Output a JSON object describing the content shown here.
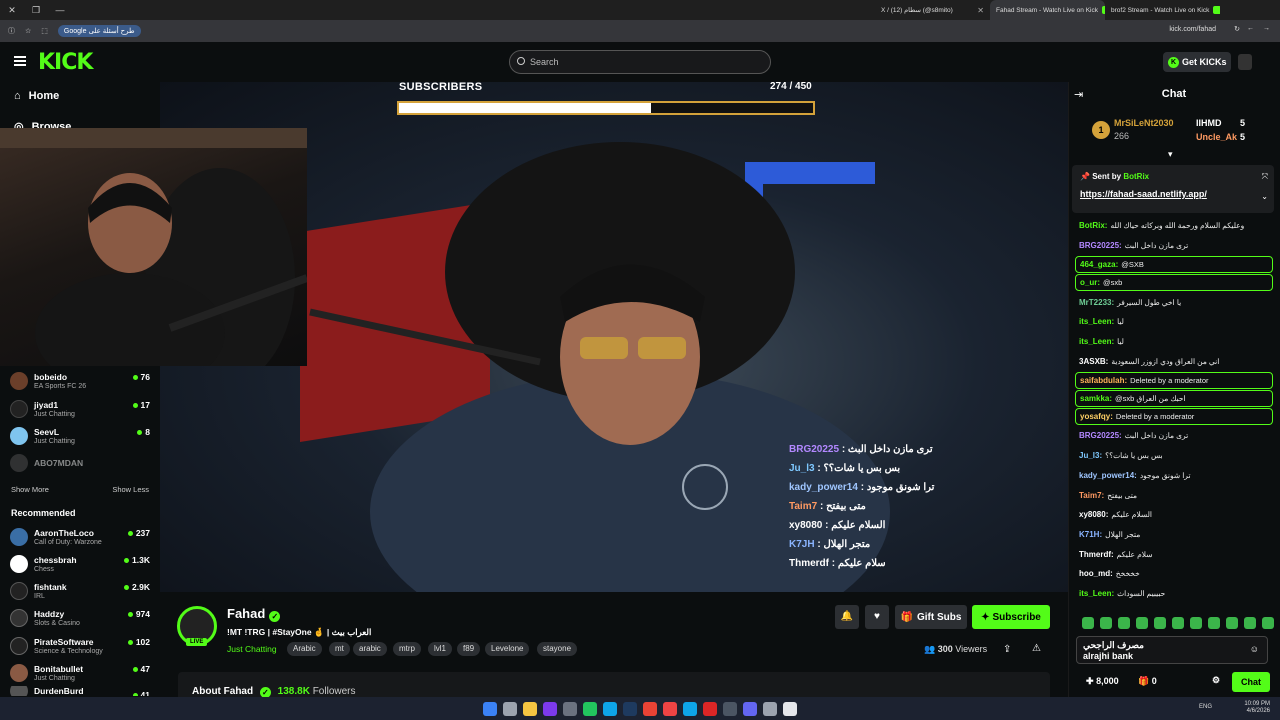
{
  "browser": {
    "tabs": [
      {
        "label": "X / (12) سطام (@s8mito)",
        "active": false
      },
      {
        "label": "Fahad Stream - Watch Live on Kick",
        "active": true
      },
      {
        "label": "brof2 Stream - Watch Live on Kick",
        "active": false
      }
    ],
    "bookmark_chip": "Google طرح أسئلة على",
    "url": "kick.com/fahad"
  },
  "kick_header": {
    "logo": "KICK",
    "search_placeholder": "Search",
    "get_kicks": "Get KICKs"
  },
  "sidebar": {
    "home": "Home",
    "browse": "Browse",
    "following": [
      {
        "name": "bobeido",
        "game": "EA Sports FC 26",
        "viewers": "76",
        "color": "#6b3f2a"
      },
      {
        "name": "jiyad1",
        "game": "Just Chatting",
        "viewers": "17",
        "color": "#222"
      },
      {
        "name": "SeevL",
        "game": "Just Chatting",
        "viewers": "8",
        "color": "#7fc4ee"
      },
      {
        "name": "ABO7MDAN",
        "game": "",
        "viewers": "",
        "color": "#555"
      }
    ],
    "show_more": "Show More",
    "show_less": "Show Less",
    "recommended_title": "Recommended",
    "recommended": [
      {
        "name": "AaronTheLoco",
        "game": "Call of Duty: Warzone",
        "viewers": "237",
        "color": "#3a6ea5"
      },
      {
        "name": "chessbrah",
        "game": "Chess",
        "viewers": "1.3K",
        "color": "#fff"
      },
      {
        "name": "fishtank",
        "game": "IRL",
        "viewers": "2.9K",
        "color": "#222"
      },
      {
        "name": "Haddzy",
        "game": "Slots & Casino",
        "viewers": "974",
        "color": "#333"
      },
      {
        "name": "PirateSoftware",
        "game": "Science & Technology",
        "viewers": "102",
        "color": "#222"
      },
      {
        "name": "Bonitabullet",
        "game": "Just Chatting",
        "viewers": "47",
        "color": "#8a5a44"
      },
      {
        "name": "DurdenBurd",
        "game": "",
        "viewers": "41",
        "color": "#555"
      }
    ]
  },
  "overlay": {
    "subscribers_label": "SUBSCRIBERS",
    "subscribers_count": "274 / 450",
    "subscribers_progress": 0.609,
    "chat": [
      {
        "user": "BRG20225",
        "text": ": ترى مازن داخل البث",
        "color": "#b388ff"
      },
      {
        "user": "Ju_l3",
        "text": ": بس بس يا شات؟؟",
        "color": "#7ec8ff"
      },
      {
        "user": "kady_power14",
        "text": ": ترا شونق موجود",
        "color": "#9fc6ff"
      },
      {
        "user": "Taim7",
        "text": ": متى بيفتح",
        "color": "#ff9a62"
      },
      {
        "user": "xy8080",
        "text": ": السلام عليكم",
        "color": "#ffffff"
      },
      {
        "user": "K7JH",
        "text": ": متجر الهلال",
        "color": "#8ab4ff"
      },
      {
        "user": "Thmerdf",
        "text": ": سلام عليكم",
        "color": "#ffffff"
      }
    ]
  },
  "stream": {
    "name": "Fahad",
    "live": "LIVE",
    "title": "!MT !TRG | #StayOne 🤞 | العراب بيث",
    "category": "Just Chatting",
    "tags": [
      "Arabic",
      "mt",
      "arabic",
      "mtrp",
      "lvl1",
      "f89",
      "Levelone",
      "stayone"
    ],
    "gift_subs": "Gift Subs",
    "subscribe": "Subscribe",
    "viewers": "300",
    "viewers_label": "Viewers",
    "about": "About Fahad",
    "followers": "138.8K",
    "followers_label": "Followers"
  },
  "chat": {
    "title": "Chat",
    "leaderboard": [
      {
        "rank": "1",
        "name": "MrSiLeNt2030",
        "score": "266"
      },
      {
        "name": "IIHMD",
        "score": "5"
      },
      {
        "name": "Uncle_Ak",
        "score": "5"
      }
    ],
    "pinned_sent_by": "Sent by",
    "pinned_user": "BotRix",
    "pinned_link": "https://fahad-saad.netlify.app/",
    "messages": [
      {
        "user": "BotRix:",
        "text": "وعليكم السلام ورحمة الله وبركاته حياك الله",
        "color": "#53fc18",
        "hl": false
      },
      {
        "user": "BRG20225:",
        "text": "ترى مازن داخل البث",
        "color": "#b388ff",
        "hl": false
      },
      {
        "user": "464_gaza:",
        "text": "@SXB",
        "color": "#53fc18",
        "hl": true
      },
      {
        "user": "o_ur:",
        "text": "@sxb",
        "color": "#53fc18",
        "hl": true
      },
      {
        "user": "MrT2233:",
        "text": "يا اخي طول السيرفر",
        "color": "#6fcf97",
        "hl": false
      },
      {
        "user": "its_Leen:",
        "text": "ليا",
        "color": "#53fc18",
        "hl": false
      },
      {
        "user": "its_Leen:",
        "text": "ليا",
        "color": "#53fc18",
        "hl": false
      },
      {
        "user": "3ASXB:",
        "text": "اني من العراق ودي ازوزر السعودية",
        "color": "#ffffff",
        "hl": false
      },
      {
        "user": "saifabdulah:",
        "text": "Deleted by a moderator",
        "color": "#ffb25a",
        "hl": true
      },
      {
        "user": "samkka:",
        "text": "@sxb احبك من العراق",
        "color": "#53fc18",
        "hl": true
      },
      {
        "user": "yosafqy:",
        "text": "Deleted by a moderator",
        "color": "#ffd166",
        "hl": true
      },
      {
        "user": "BRG20225:",
        "text": "ترى مازن داخل البث",
        "color": "#b388ff",
        "hl": false
      },
      {
        "user": "Ju_l3:",
        "text": "بس بس يا شات؟؟",
        "color": "#7ec8ff",
        "hl": false
      },
      {
        "user": "kady_power14:",
        "text": "ترا شونق موجود",
        "color": "#9fc6ff",
        "hl": false
      },
      {
        "user": "Taim7:",
        "text": "متى بيفتح",
        "color": "#ff9a62",
        "hl": false
      },
      {
        "user": "xy8080:",
        "text": "السلام عليكم",
        "color": "#ffffff",
        "hl": false
      },
      {
        "user": "K71H:",
        "text": "متجر الهلال",
        "color": "#8ab4ff",
        "hl": false
      },
      {
        "user": "Thmerdf:",
        "text": "سلام عليكم",
        "color": "#ffffff",
        "hl": false
      },
      {
        "user": "hoo_md:",
        "text": "خخخخخ",
        "color": "#ffffff",
        "hl": false
      },
      {
        "user": "its_Leen:",
        "text": "حبيبيم السوداث",
        "color": "#53fc18",
        "hl": false
      }
    ],
    "sponsor_ar": "مصرف الراجحي",
    "sponsor_en": "alrajhi bank",
    "points": "8,000",
    "gifts": "0",
    "send": "Chat"
  },
  "taskbar": {
    "lang": "ENG",
    "time": "10:09 PM",
    "date": "4/6/2026"
  }
}
